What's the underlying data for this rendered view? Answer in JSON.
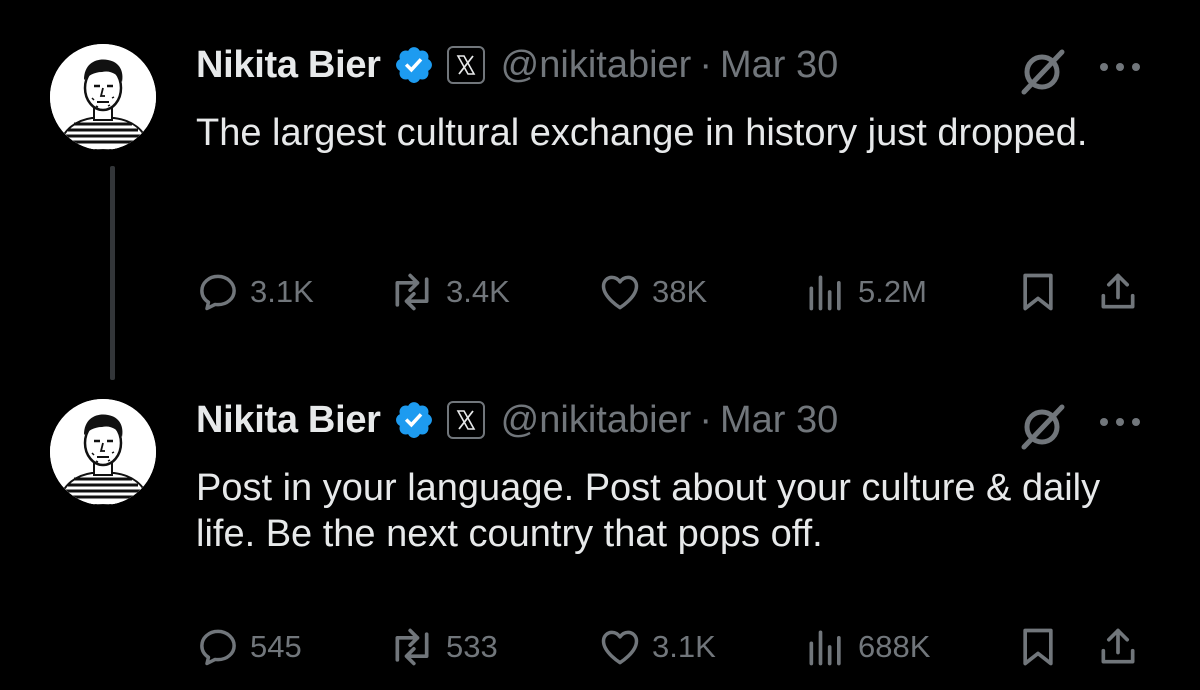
{
  "colors": {
    "background": "#000000",
    "primary_text": "#e7e9ea",
    "secondary_text": "#71767b",
    "verified_blue": "#1d9bf0",
    "thread_line": "#333639"
  },
  "tweets": [
    {
      "author": {
        "display_name": "Nikita Bier",
        "handle": "@nikitabier",
        "verified": true,
        "affiliate_badge": "x-logo-icon"
      },
      "separator": "·",
      "date": "Mar 30",
      "text": "The largest cultural exchange in history just dropped.",
      "stats": {
        "replies": "3.1K",
        "reposts": "3.4K",
        "likes": "38K",
        "views": "5.2M"
      }
    },
    {
      "author": {
        "display_name": "Nikita Bier",
        "handle": "@nikitabier",
        "verified": true,
        "affiliate_badge": "x-logo-icon"
      },
      "separator": "·",
      "date": "Mar 30",
      "text": "Post in your language. Post about your culture & daily life. Be the next country that pops off.",
      "stats": {
        "replies": "545",
        "reposts": "533",
        "likes": "3.1K",
        "views": "688K"
      }
    }
  ]
}
